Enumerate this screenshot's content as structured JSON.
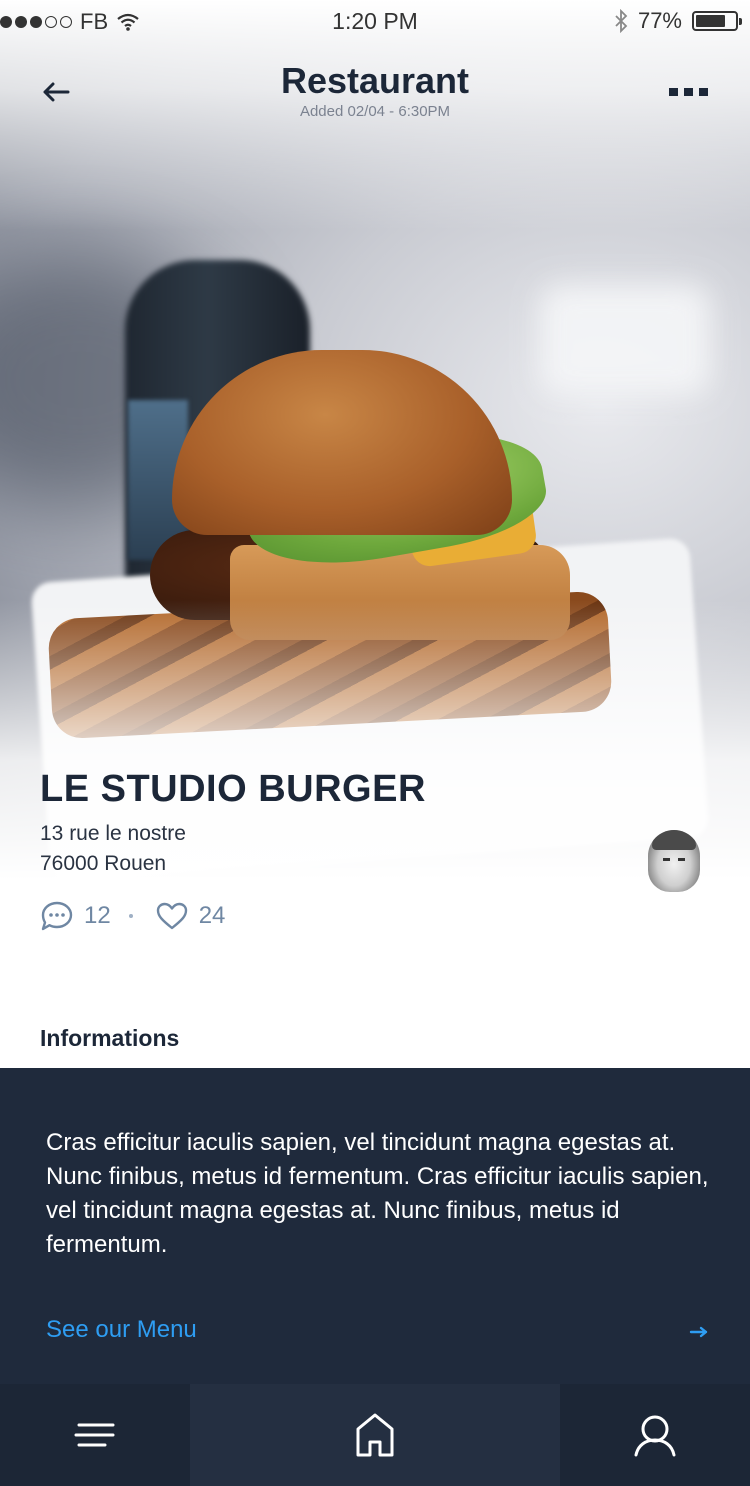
{
  "status_bar": {
    "carrier": "FB",
    "time": "1:20 PM",
    "battery": "77%",
    "battery_level": 0.77
  },
  "header": {
    "title": "Restaurant",
    "subtitle": "Added 02/04 - 6:30PM",
    "back_icon": "arrow-left-icon",
    "more_icon": "more-horizontal-icon"
  },
  "restaurant": {
    "name": "LE STUDIO BURGER",
    "address_line1": "13 rue le nostre",
    "address_line2": "76000 Rouen",
    "comments_count": "12",
    "likes_count": "24"
  },
  "informations": {
    "title": "Informations",
    "description": "Cras efficitur iaculis sapien, vel tincidunt magna egestas at. Nunc finibus, metus id fermentum. Cras efficitur iaculis sapien, vel tincidunt magna egestas at. Nunc finibus, metus id fermentum.",
    "menu_link": "See our Menu"
  },
  "colors": {
    "accent": "#2e9df2",
    "panel_background": "#1f2a3c",
    "tabbar_background": "#1c2636",
    "stat_color": "#6f87a3",
    "text_dark": "#1c2738"
  },
  "tabbar": {
    "items": [
      {
        "icon": "menu-icon",
        "active": false
      },
      {
        "icon": "home-icon",
        "active": true
      },
      {
        "icon": "user-icon",
        "active": false
      }
    ]
  }
}
